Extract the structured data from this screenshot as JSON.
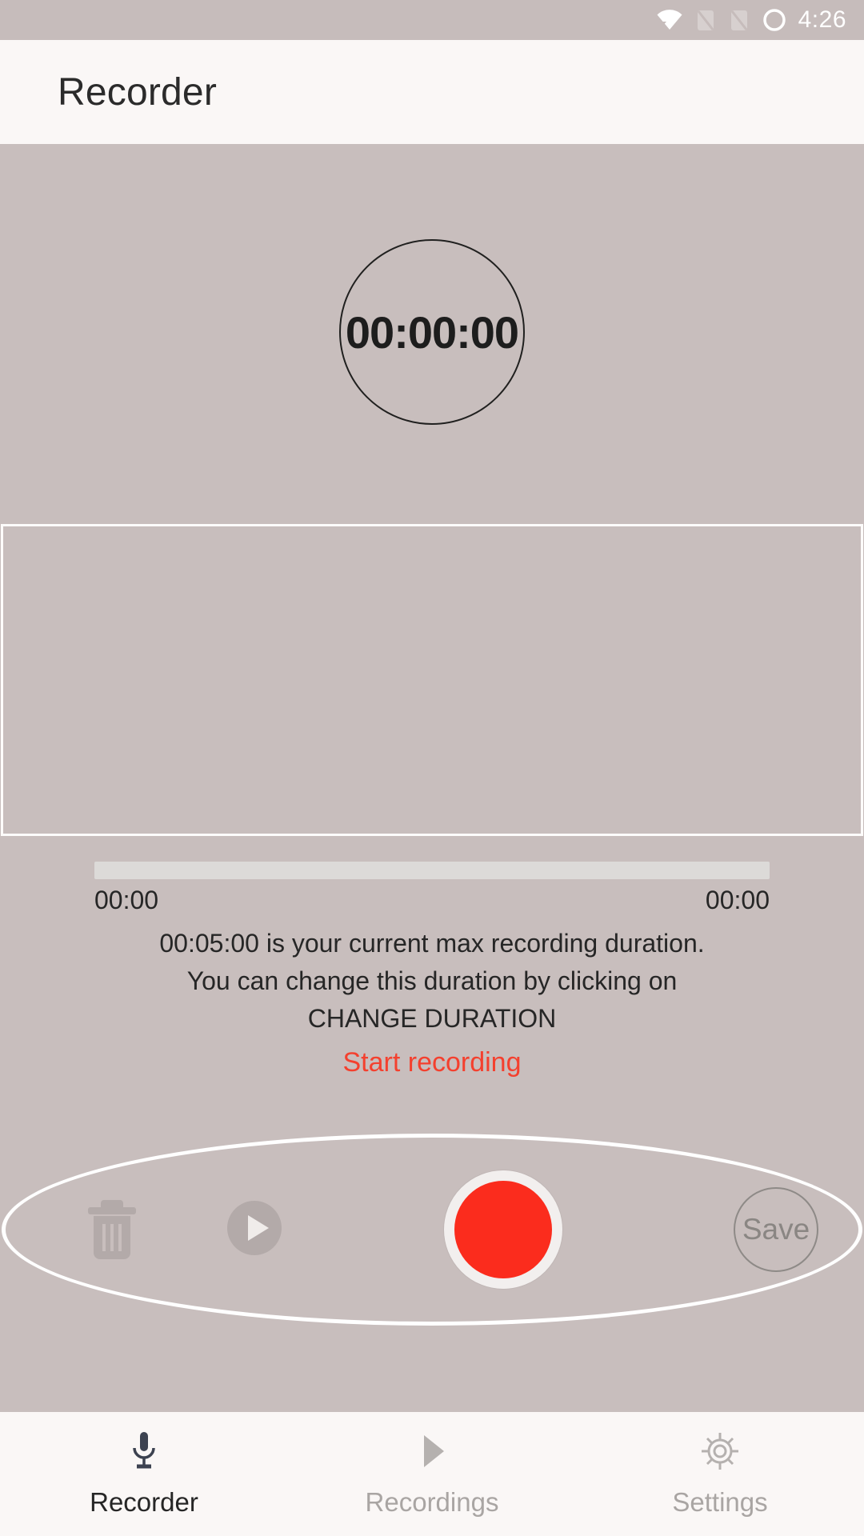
{
  "status_bar": {
    "time": "4:26",
    "icons": [
      "wifi-icon",
      "signal-off-icon",
      "signal-off-icon",
      "circle-icon"
    ]
  },
  "app_bar": {
    "title": "Recorder"
  },
  "timer": {
    "value": "00:00:00"
  },
  "waveform": {
    "label": "waveform-display"
  },
  "seek": {
    "progress_percent": 0,
    "current_time": "00:00",
    "total_time": "00:00"
  },
  "info": {
    "line1": "00:05:00 is your current max recording duration.",
    "line2": "You can change this duration by clicking on",
    "line3": "CHANGE DURATION",
    "status": "Start recording",
    "status_color": "#f4402e"
  },
  "controls": {
    "delete_label": "Delete",
    "play_label": "Play",
    "record_label": "Record",
    "save_label": "Save",
    "record_color": "#fb2c1d"
  },
  "bottom_nav": {
    "items": [
      {
        "label": "Recorder",
        "icon": "microphone-icon",
        "active": true
      },
      {
        "label": "Recordings",
        "icon": "play-icon",
        "active": false
      },
      {
        "label": "Settings",
        "icon": "gear-icon",
        "active": false
      }
    ]
  }
}
